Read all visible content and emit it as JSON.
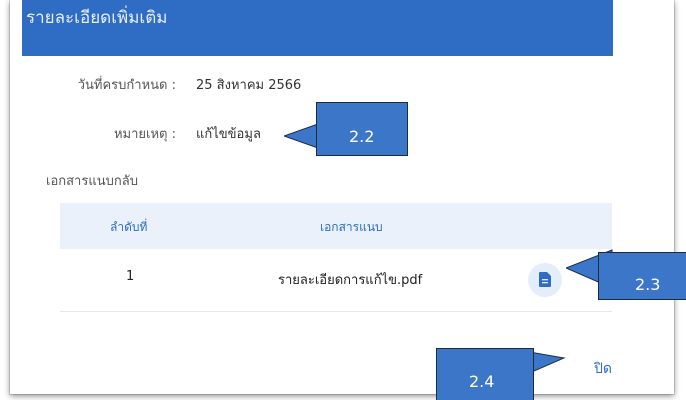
{
  "dialog": {
    "title": "รายละเอียดเพิ่มเติม",
    "due_date_label": "วันที่ครบกำหนด :",
    "due_date_value": "25 สิงหาคม 2566",
    "remark_label": "หมายเหตุ :",
    "remark_value": "แก้ไขข้อมูล",
    "returned_docs_title": "เอกสารแนบกลับ",
    "table": {
      "headers": [
        "ลำดับที่",
        "เอกสารแนบ"
      ],
      "rows": [
        {
          "no": "1",
          "file": "รายละเอียดการแก้ไข.pdf"
        }
      ]
    },
    "close_label": "ปิด"
  },
  "callouts": {
    "c22": "2.2",
    "c23": "2.3",
    "c24": "2.4"
  },
  "icons": {
    "file": "document-icon"
  },
  "colors": {
    "header": "#2f6cc4",
    "callout": "#3b76c8",
    "table_header_bg": "#eaf1fb"
  }
}
